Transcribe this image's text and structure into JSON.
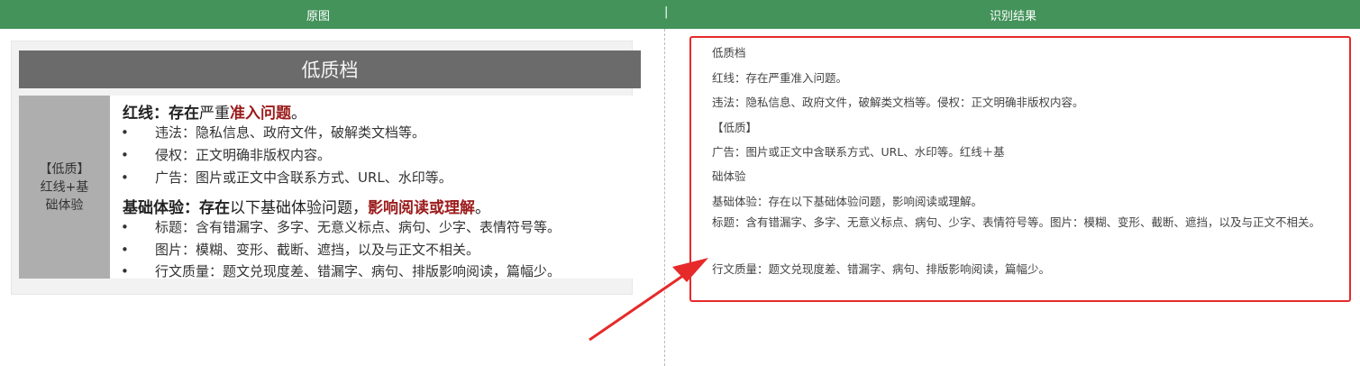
{
  "topbar": {
    "left_label": "原图",
    "separator": "|",
    "right_label": "识别结果"
  },
  "source_image": {
    "header": "低质档",
    "sidebar_lines": [
      "【低质】",
      "红线+基",
      "础体验"
    ],
    "redline": {
      "title_bold": "红线：存在",
      "title_normal": "严重",
      "title_red": "准入问题",
      "title_end": "。",
      "bullets": [
        "违法：隐私信息、政府文件，破解类文档等。",
        "侵权：正文明确非版权内容。",
        "广告：图片或正文中含联系方式、URL、水印等。"
      ]
    },
    "basic": {
      "title_bold": "基础体验：存在",
      "title_normal": "以下基础体验问题，",
      "title_red": "影响阅读或理解",
      "title_end": "。",
      "bullets": [
        "标题：含有错漏字、多字、无意义标点、病句、少字、表情符号等。",
        "图片：模糊、变形、截断、遮挡，以及与正文不相关。",
        "行文质量：题文兑现度差、错漏字、病句、排版影响阅读，篇幅少。"
      ]
    },
    "bullet_symbol": "•"
  },
  "result": {
    "lines": [
      "低质档",
      "红线：存在严重准入问题。",
      "违法：隐私信息、政府文件，破解类文档等。侵权：正文明确非版权内容。",
      "【低质】",
      "广告：图片或正文中含联系方式、URL、水印等。红线＋基",
      "础体验",
      "基础体验：存在以下基础体验问题，影响阅读或理解。"
    ],
    "wrapped_line": "标题：含有错漏字、多字、无意义标点、病句、少字、表情符号等。图片：模糊、变形、截断、遮挡，以及与正文不相关。",
    "last_line": "行文质量：题文兑现度差、错漏字、病句、排版影响阅读，篇幅少。"
  },
  "colors": {
    "topbar": "#43935a",
    "highlight_box": "#e62a2a",
    "arrow": "#e62a2a",
    "accent_red_text": "#9b1b1b"
  }
}
